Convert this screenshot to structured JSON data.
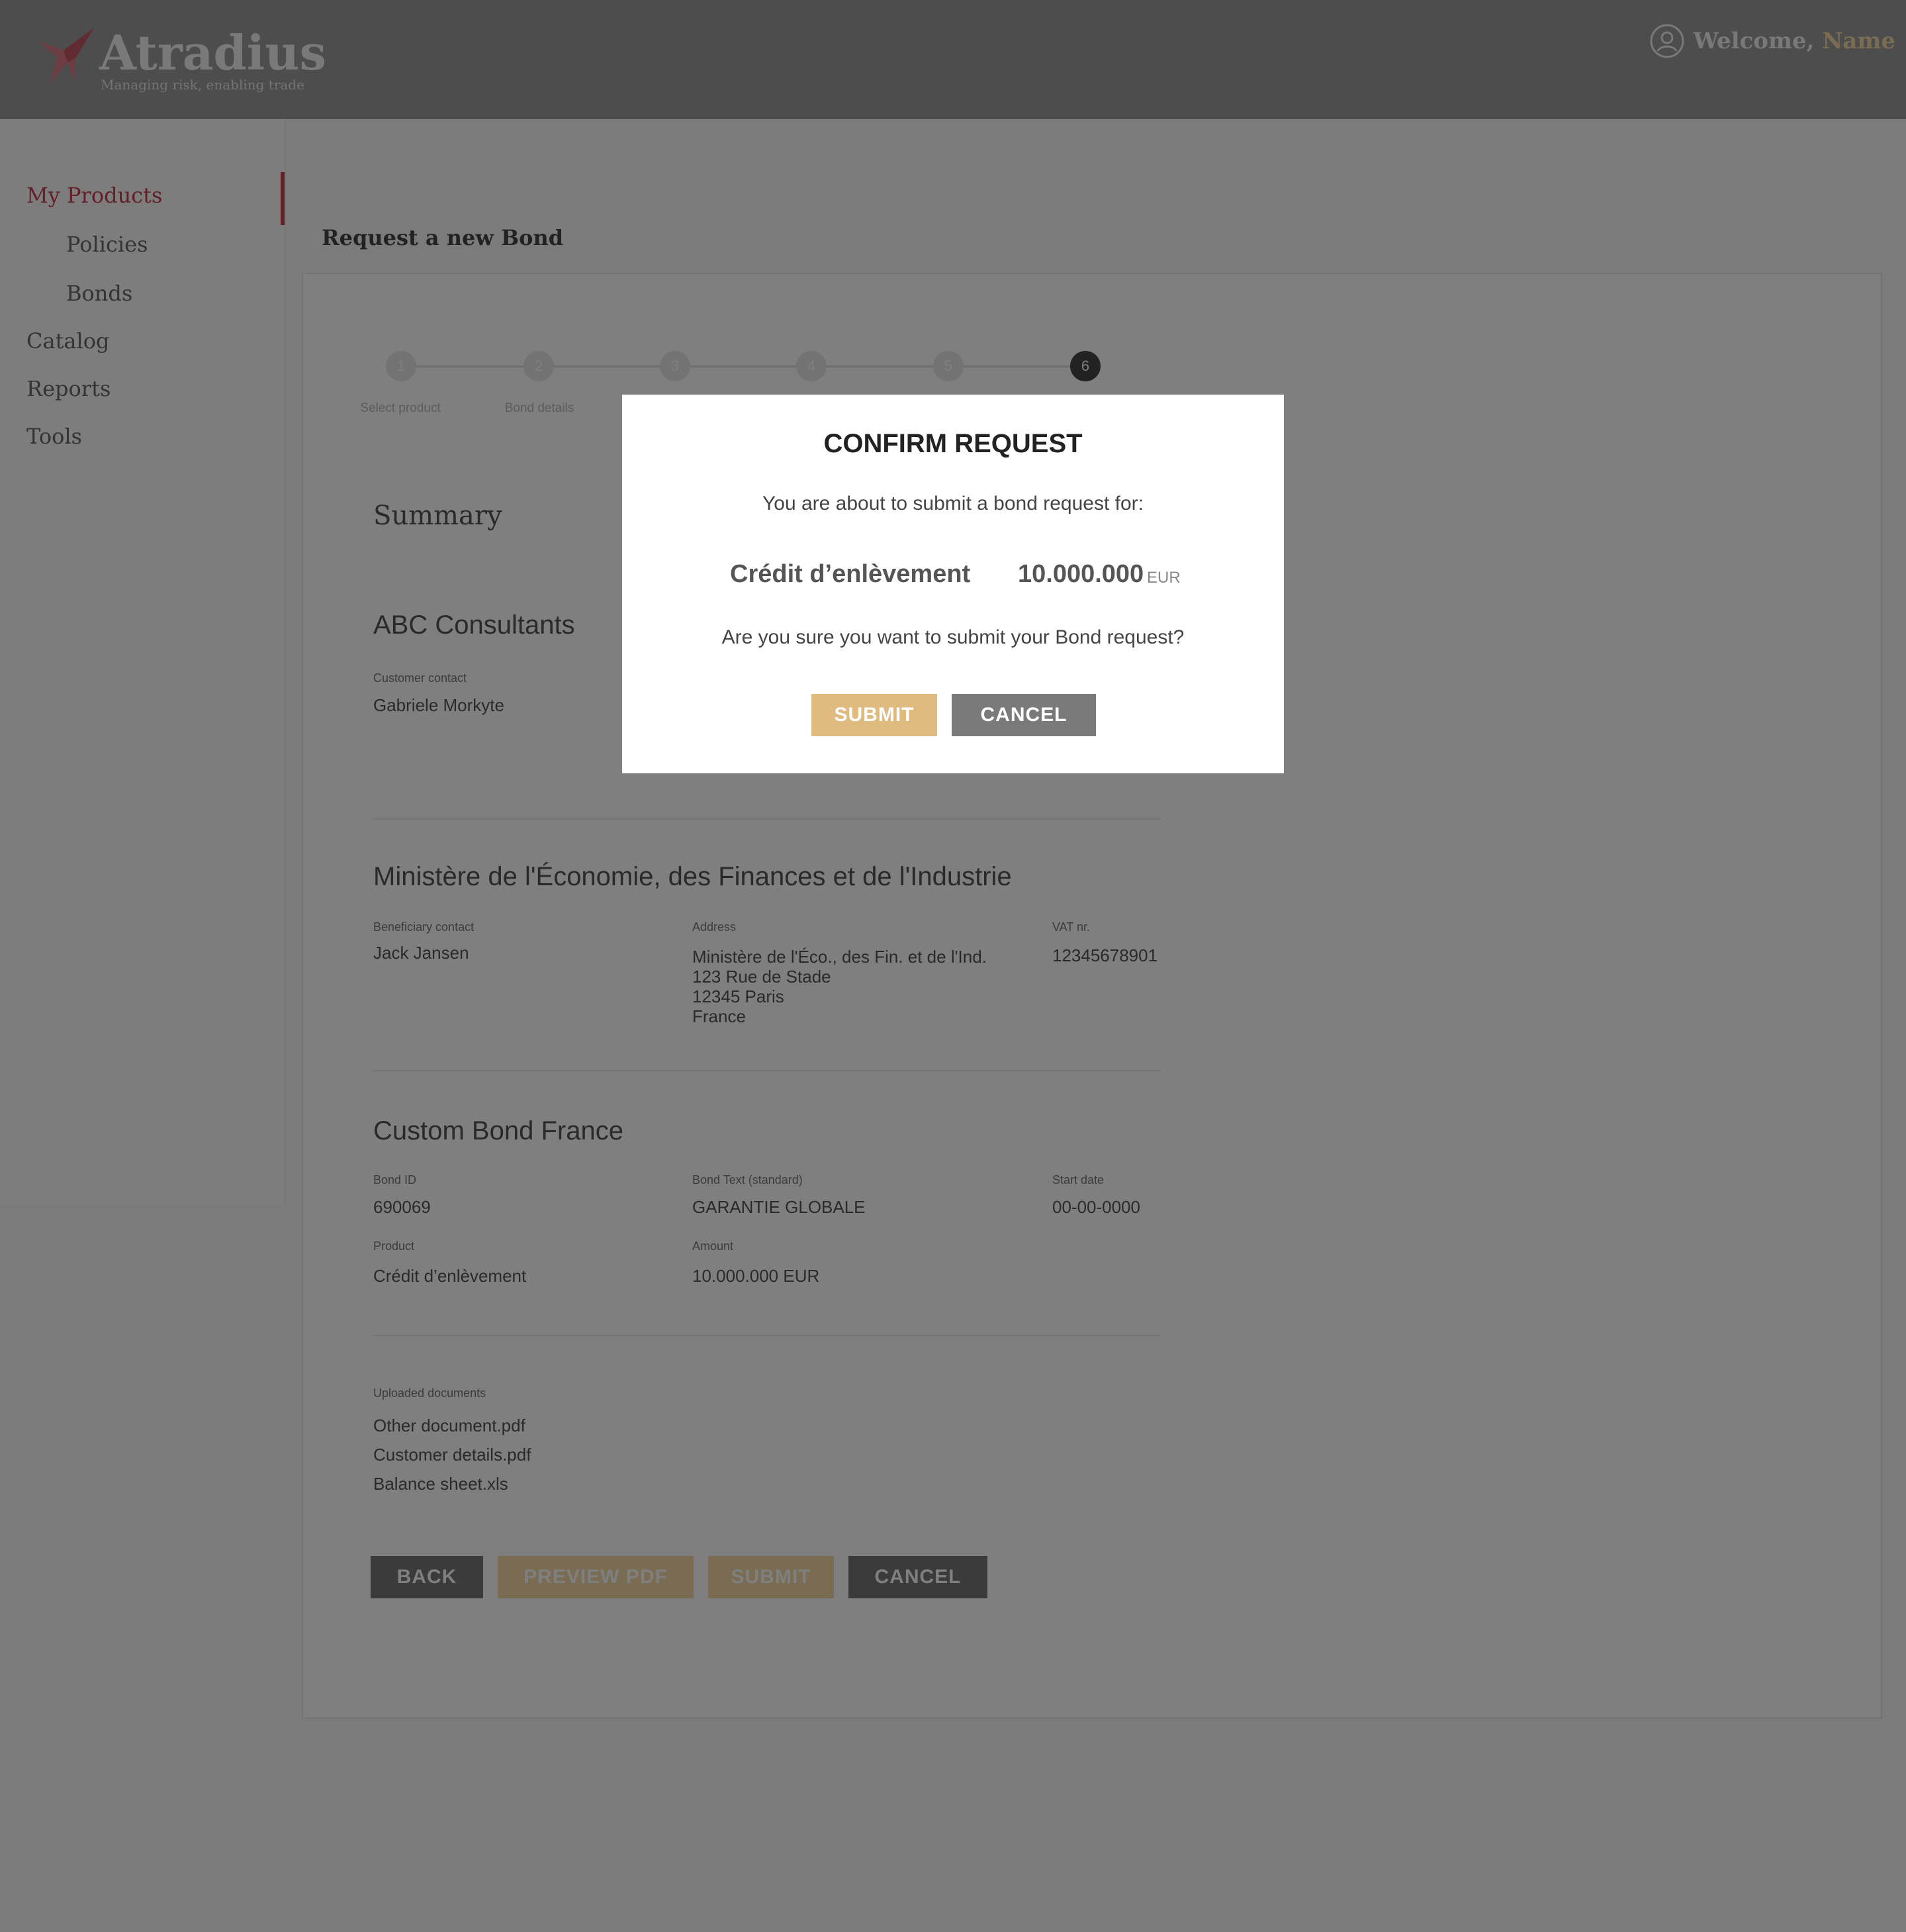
{
  "header": {
    "logo_text": "Atradius",
    "logo_tagline": "Managing risk, enabling trade",
    "welcome_prefix": "Welcome,",
    "welcome_name": "Name"
  },
  "sidebar": {
    "items": [
      {
        "label": "My Products"
      },
      {
        "label": "Policies"
      },
      {
        "label": "Bonds"
      },
      {
        "label": "Catalog"
      },
      {
        "label": "Reports"
      },
      {
        "label": "Tools"
      }
    ]
  },
  "page_title": "Request a new Bond",
  "stepper": {
    "steps": [
      {
        "number": "1",
        "label": "Select product"
      },
      {
        "number": "2",
        "label": "Bond details"
      },
      {
        "number": "3",
        "label": ""
      },
      {
        "number": "4",
        "label": ""
      },
      {
        "number": "5",
        "label": ""
      },
      {
        "number": "6",
        "label": ""
      }
    ],
    "active_step": 6
  },
  "summary": {
    "title": "Summary",
    "customer": {
      "name": "ABC Consultants",
      "contact_label": "Customer contact",
      "contact_value": "Gabriele Morkyte"
    },
    "beneficiary": {
      "name": "Ministère de l'Économie, des Finances et de l'Industrie",
      "contact_label": "Beneficiary contact",
      "contact_value": "Jack Jansen",
      "address_label": "Address",
      "address_lines": [
        "Ministère de l'Éco., des Fin. et de l'Ind.",
        "123 Rue de Stade",
        "12345 Paris",
        "France"
      ],
      "vat_label": "VAT nr.",
      "vat_value": "12345678901"
    },
    "bond": {
      "name": "Custom Bond France",
      "id_label": "Bond ID",
      "id_value": "690069",
      "text_label": "Bond Text (standard)",
      "text_value": "GARANTIE GLOBALE",
      "start_label": "Start date",
      "start_value": "00-00-0000",
      "product_label": "Product",
      "product_value": "Crédit d’enlèvement",
      "amount_label": "Amount",
      "amount_value": "10.000.000 EUR"
    },
    "documents": {
      "label": "Uploaded documents",
      "files": [
        "Other document.pdf",
        "Customer details.pdf",
        "Balance sheet.xls"
      ]
    }
  },
  "actions": {
    "back": "BACK",
    "preview": "PREVIEW PDF",
    "submit": "SUBMIT",
    "cancel": "CANCEL"
  },
  "modal": {
    "title": "CONFIRM REQUEST",
    "subtitle": "You are about to submit a bond request for:",
    "product": "Crédit d’enlèvement",
    "amount": "10.000.000",
    "currency": "EUR",
    "question": "Are you sure you want to submit your Bond request?",
    "submit_label": "SUBMIT",
    "cancel_label": "CANCEL"
  },
  "colors": {
    "brand_red": "#c63d4f",
    "gold": "#f3d9a4",
    "button_gray": "#777777",
    "overlay": "rgba(0,0,0,0.5)"
  },
  "icons": [
    "atradius-logo-icon",
    "user-icon"
  ]
}
